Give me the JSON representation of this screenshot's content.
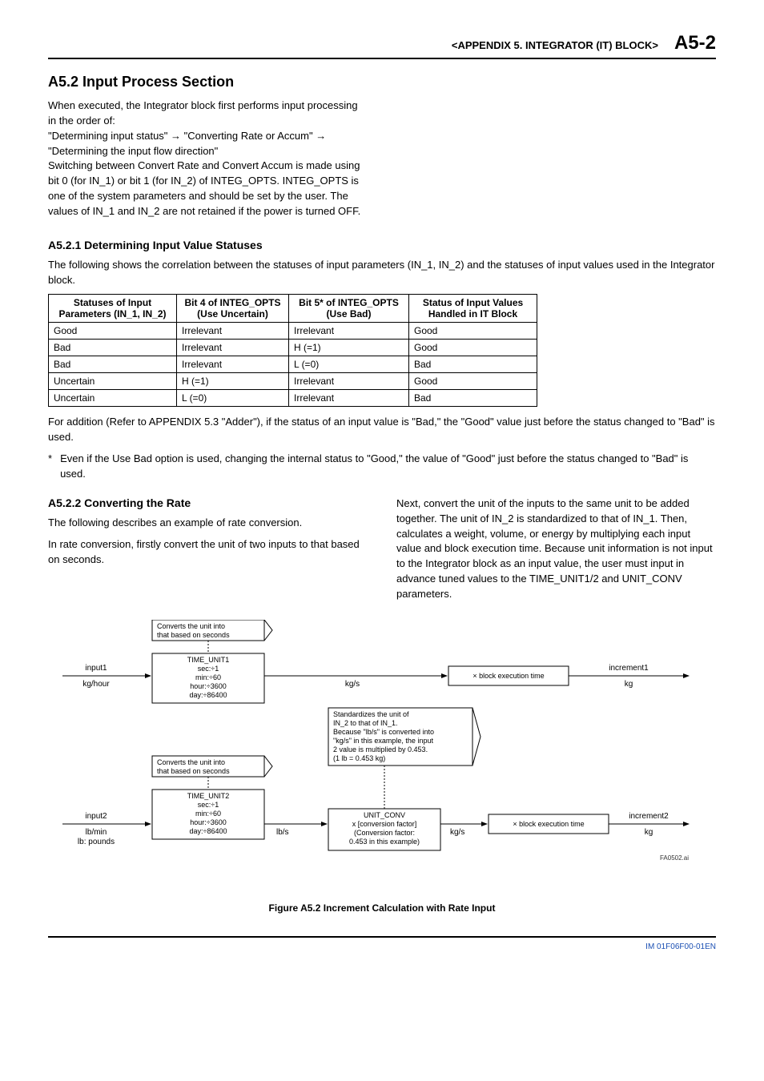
{
  "header": {
    "chapter": "<APPENDIX 5.  INTEGRATOR (IT) BLOCK>",
    "page": "A5-2"
  },
  "section": {
    "title": "A5.2  Input Process Section",
    "intro": "When executed, the Integrator block first performs input processing in the order of:\n\"Determining input status\" → \"Converting Rate or Accum\" → \"Determining the input flow direction\"\nSwitching between Convert Rate and Convert Accum is made using bit 0 (for IN_1) or bit 1 (for IN_2) of INTEG_OPTS. INTEG_OPTS is one of the system parameters and should be set by the user. The values of IN_1 and IN_2 are not retained if the power is turned OFF."
  },
  "sub1": {
    "title": "A5.2.1 Determining Input Value Statuses",
    "lead": "The following shows the correlation between the statuses of input parameters (IN_1, IN_2) and the statuses of input values used in the Integrator block.",
    "table": {
      "headers": [
        "Statuses of Input Parameters (IN_1, IN_2)",
        "Bit 4 of INTEG_OPTS (Use Uncertain)",
        "Bit 5* of INTEG_OPTS (Use Bad)",
        "Status of Input Values Handled in IT Block"
      ],
      "rows": [
        [
          "Good",
          "Irrelevant",
          "Irrelevant",
          "Good"
        ],
        [
          "Bad",
          "Irrelevant",
          "H (=1)",
          "Good"
        ],
        [
          "Bad",
          "Irrelevant",
          "L (=0)",
          "Bad"
        ],
        [
          "Uncertain",
          "H (=1)",
          "Irrelevant",
          "Good"
        ],
        [
          "Uncertain",
          "L (=0)",
          "Irrelevant",
          "Bad"
        ]
      ]
    },
    "after": "For addition (Refer to APPENDIX 5.3 \"Adder\"), if the status of an input value is \"Bad,\" the \"Good\" value just before the status changed to \"Bad\" is used.",
    "footnote_mark": "*",
    "footnote": "Even if the Use Bad option is used, changing the internal status to \"Good,\" the value of \"Good\" just before the status changed to \"Bad\" is used."
  },
  "sub2": {
    "title": "A5.2.2 Converting the Rate",
    "left1": "The following describes an example of rate conversion.",
    "left2": "In rate conversion, firstly convert the unit of two inputs to that based on seconds.",
    "right": "Next, convert the unit of the inputs to the same unit to be added together. The unit of IN_2 is standardized to that of IN_1. Then, calculates a weight, volume, or energy by multiplying each input value and block execution time. Because unit information is not input to the Integrator block as an input value, the user must input in advance tuned values to the TIME_UNIT1/2 and UNIT_CONV parameters."
  },
  "diagram": {
    "convHeader1": "Converts the unit into",
    "convHeader2": "that based on seconds",
    "input1": "input1",
    "input1_unit": "kg/hour",
    "timeunit1_title": "TIME_UNIT1",
    "tu_sec": "sec:÷1",
    "tu_min": "min:÷60",
    "tu_hour": "hour:÷3600",
    "tu_day": "day:÷86400",
    "kg_s": "kg/s",
    "blockexec": "× block execution time",
    "increment1": "increment1",
    "kg": "kg",
    "std_l1": "Standardizes the unit of",
    "std_l2": "IN_2 to that of IN_1.",
    "std_l3": "Because \"lb/s\" is converted into",
    "std_l4": "\"kg/s\" in this example, the input",
    "std_l5": "2 value is multiplied by 0.453.",
    "std_l6": "(1 lb = 0.453 kg)",
    "input2": "input2",
    "input2_unit1": "lb/min",
    "input2_unit2": "lb: pounds",
    "timeunit2_title": "TIME_UNIT2",
    "lb_s": "lb/s",
    "unitconv_title": "UNIT_CONV",
    "unitconv_l1": "x [conversion factor]",
    "unitconv_l2": "(Conversion factor:",
    "unitconv_l3": "0.453 in this example)",
    "increment2": "increment2",
    "code": "FA0502.ai",
    "caption": "Figure A5.2   Increment Calculation with Rate Input"
  },
  "footer": {
    "doc": "IM 01F06F00-01EN"
  }
}
